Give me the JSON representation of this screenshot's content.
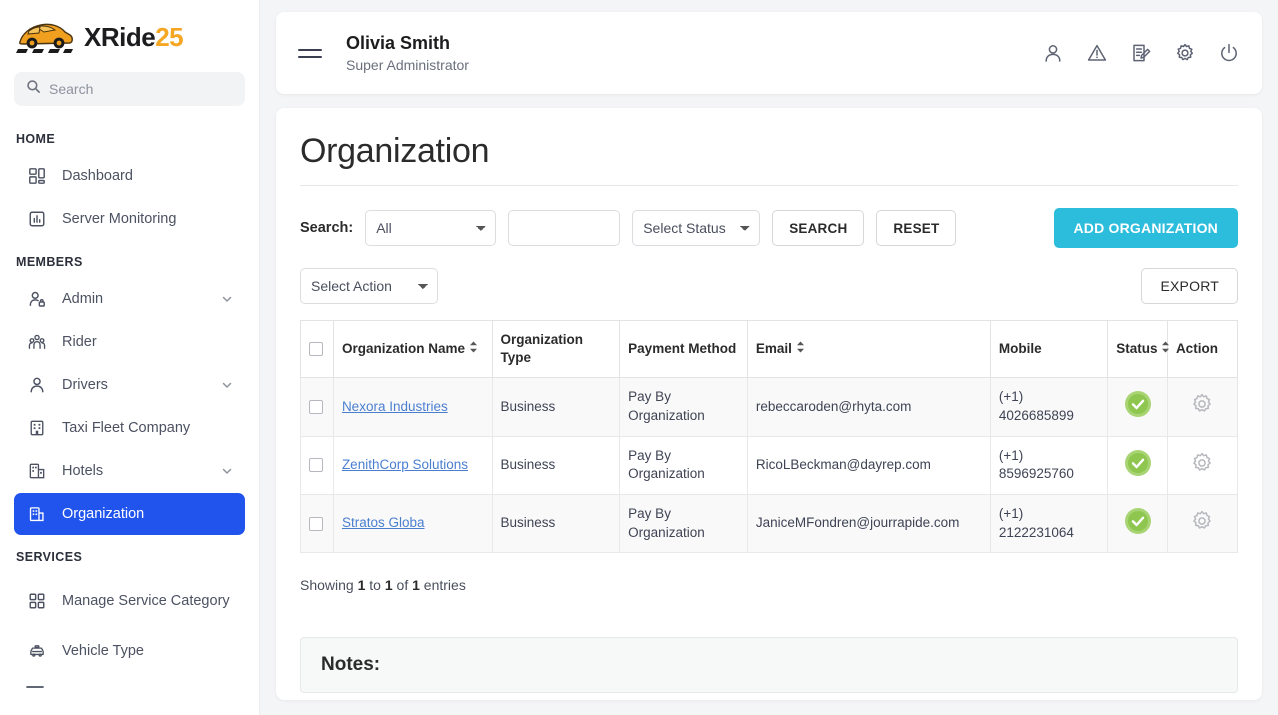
{
  "brand": {
    "name_main": "XRide",
    "name_suffix": "25",
    "logo_icon": "car-icon"
  },
  "sidebar": {
    "search_placeholder": "Search",
    "search_value": "",
    "sections": [
      {
        "title": "HOME",
        "items": [
          {
            "label": "Dashboard",
            "icon": "dashboard-grid-icon",
            "expandable": false
          },
          {
            "label": "Server Monitoring",
            "icon": "bar-chart-icon",
            "expandable": false
          }
        ]
      },
      {
        "title": "MEMBERS",
        "items": [
          {
            "label": "Admin",
            "icon": "user-lock-icon",
            "expandable": true
          },
          {
            "label": "Rider",
            "icon": "users-group-icon",
            "expandable": false
          },
          {
            "label": "Drivers",
            "icon": "user-icon",
            "expandable": true
          },
          {
            "label": "Taxi Fleet Company",
            "icon": "building-icon",
            "expandable": false
          },
          {
            "label": "Hotels",
            "icon": "hotel-icon",
            "expandable": true
          },
          {
            "label": "Organization",
            "icon": "organization-icon",
            "expandable": false,
            "active": true
          }
        ]
      },
      {
        "title": "SERVICES",
        "items": [
          {
            "label": "Manage Service Category",
            "icon": "category-grid-icon",
            "expandable": false
          },
          {
            "label": "Vehicle Type",
            "icon": "taxi-icon",
            "expandable": false
          }
        ]
      }
    ]
  },
  "topbar": {
    "menu_icon": "hamburger-icon",
    "user_name": "Olivia Smith",
    "user_role": "Super Administrator",
    "icons": [
      {
        "name": "profile-icon"
      },
      {
        "name": "alert-triangle-icon"
      },
      {
        "name": "document-edit-icon"
      },
      {
        "name": "settings-gear-icon"
      },
      {
        "name": "power-icon"
      }
    ]
  },
  "page": {
    "title": "Organization",
    "filters": {
      "search_label": "Search:",
      "scope_selected": "All",
      "scope_options": [
        "All"
      ],
      "query_value": "",
      "query_placeholder": "",
      "status_selected": "Select Status",
      "status_options": [
        "Select Status"
      ],
      "search_button": "SEARCH",
      "reset_button": "RESET",
      "add_button": "ADD ORGANIZATION"
    },
    "actions": {
      "select_action_selected": "Select Action",
      "select_action_options": [
        "Select Action"
      ],
      "export_button": "EXPORT"
    },
    "table": {
      "columns": [
        {
          "key": "checkbox",
          "label": "",
          "sortable": false
        },
        {
          "key": "name",
          "label": "Organization Name",
          "sortable": true
        },
        {
          "key": "type",
          "label": "Organization Type",
          "sortable": false
        },
        {
          "key": "payment",
          "label": "Payment Method",
          "sortable": false
        },
        {
          "key": "email",
          "label": "Email",
          "sortable": true
        },
        {
          "key": "mobile",
          "label": "Mobile",
          "sortable": false
        },
        {
          "key": "status",
          "label": "Status",
          "sortable": true
        },
        {
          "key": "action",
          "label": "Action",
          "sortable": false
        }
      ],
      "rows": [
        {
          "name": "Nexora Industries",
          "type": "Business",
          "payment": "Pay By Organization",
          "email": "rebeccaroden@rhyta.com",
          "mobile": "(+1) 4026685899",
          "status": "active",
          "status_icon": "check-circle-icon",
          "action_icon": "gear-icon"
        },
        {
          "name": "ZenithCorp Solutions",
          "type": "Business",
          "payment": "Pay By Organization",
          "email": "RicoLBeckman@dayrep.com",
          "mobile": "(+1) 8596925760",
          "status": "active",
          "status_icon": "check-circle-icon",
          "action_icon": "gear-icon"
        },
        {
          "name": "Stratos Globa",
          "type": "Business",
          "payment": "Pay By Organization",
          "email": "JaniceMFondren@jourrapide.com",
          "mobile": "(+1) 2122231064",
          "status": "active",
          "status_icon": "check-circle-icon",
          "action_icon": "gear-icon"
        }
      ],
      "entries_text_prefix": "Showing ",
      "entries_from": "1",
      "entries_mid": " to ",
      "entries_to": "1",
      "entries_of": " of ",
      "entries_total": "1",
      "entries_suffix": " entries"
    },
    "notes": {
      "title": "Notes:"
    }
  },
  "colors": {
    "accent_blue": "#2154ed",
    "accent_cyan": "#2cbcdc",
    "logo_orange": "#f5a623",
    "status_green": "#8ec64f",
    "link_blue": "#4a7fd0"
  }
}
